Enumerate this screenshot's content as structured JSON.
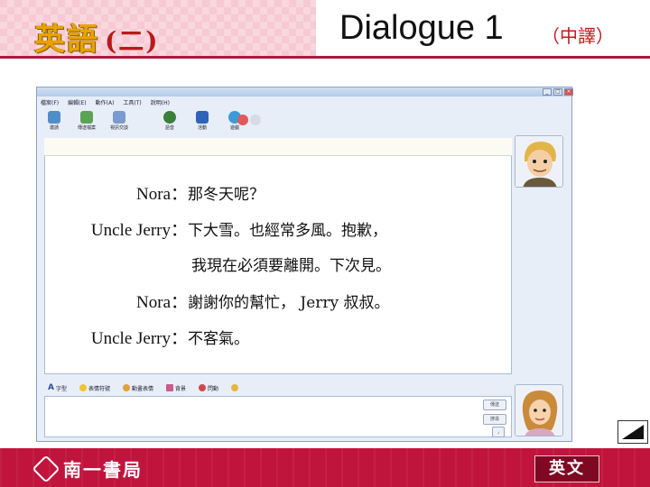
{
  "header": {
    "logo_text": "英語",
    "logo_sub": "(二)",
    "title": "Dialogue 1",
    "title_note": "（中譯）"
  },
  "window": {
    "menu": [
      "檔案(F)",
      "編輯(E)",
      "動作(A)",
      "工具(T)",
      "說明(H)"
    ],
    "toolbar": [
      "邀請",
      "傳送檔案",
      "視訊交談",
      "語音",
      "活動",
      "遊戲"
    ],
    "format_bar": [
      "字型",
      "表情符號",
      "動畫表情",
      "背景",
      "閃動"
    ],
    "buttons": {
      "send": "傳送",
      "search": "搜尋"
    }
  },
  "dialogue": [
    {
      "speaker": "Nora：",
      "text": "那冬天呢？"
    },
    {
      "speaker": "Uncle Jerry：",
      "text": "下大雪。也經常多風。抱歉，"
    },
    {
      "speaker": "",
      "text": "我現在必須要離開。下次見。"
    },
    {
      "speaker": "Nora：",
      "text": "謝謝你的幫忙， Jerry 叔叔。"
    },
    {
      "speaker": "Uncle Jerry：",
      "text": "不客氣。"
    }
  ],
  "footer": {
    "publisher": "南一書局",
    "language_button": "英文"
  },
  "colors": {
    "header_pink": "#f6c9d3",
    "footer_red": "#c1143d",
    "button_dark": "#7f0822"
  }
}
